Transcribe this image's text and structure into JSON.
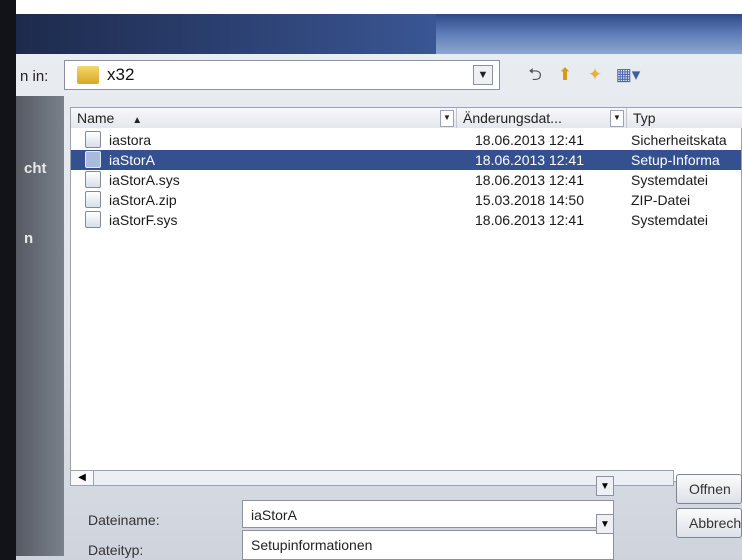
{
  "dialog": {
    "look_in_label": "n in:",
    "current_folder": "x32",
    "places": [
      "cht",
      "n"
    ]
  },
  "toolbar": {
    "icons": [
      "back-icon",
      "up-folder-icon",
      "new-folder-icon",
      "view-menu-icon"
    ]
  },
  "columns": {
    "name": "Name",
    "date": "Änderungsdat...",
    "type": "Typ"
  },
  "files": [
    {
      "name": "iastora",
      "date": "18.06.2013 12:41",
      "type": "Sicherheitskata",
      "selected": false
    },
    {
      "name": "iaStorA",
      "date": "18.06.2013 12:41",
      "type": "Setup-Informa",
      "selected": true
    },
    {
      "name": "iaStorA.sys",
      "date": "18.06.2013 12:41",
      "type": "Systemdatei",
      "selected": false
    },
    {
      "name": "iaStorA.zip",
      "date": "15.03.2018 14:50",
      "type": "ZIP-Datei",
      "selected": false
    },
    {
      "name": "iaStorF.sys",
      "date": "18.06.2013 12:41",
      "type": "Systemdatei",
      "selected": false
    }
  ],
  "filename": {
    "label": "Dateiname:",
    "value": "iaStorA"
  },
  "filetype": {
    "label": "Dateityp:",
    "value": "Setupinformationen"
  },
  "buttons": {
    "open": "Offnen",
    "cancel": "Abbreche"
  }
}
